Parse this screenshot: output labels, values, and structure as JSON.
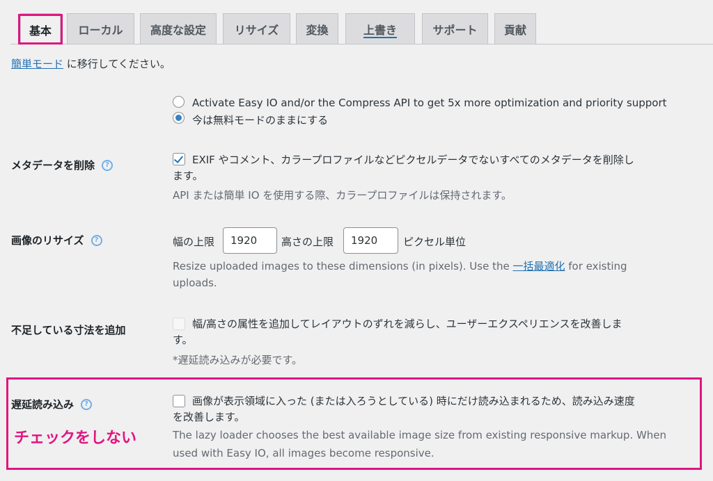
{
  "tabs": [
    {
      "label": "基本",
      "active": true
    },
    {
      "label": "ローカル"
    },
    {
      "label": "高度な設定"
    },
    {
      "label": "リサイズ"
    },
    {
      "label": "変換"
    },
    {
      "label": "上書き"
    },
    {
      "label": "サポート"
    },
    {
      "label": "貢献"
    }
  ],
  "easy_mode": {
    "link": "簡単モード",
    "text": " に移行してください。"
  },
  "mode_options": {
    "option1": "Activate Easy IO and/or the Compress API to get 5x more optimization and priority support",
    "option2": "今は無料モードのままにする",
    "selected": "option2"
  },
  "metadata": {
    "label": "メタデータを削除",
    "checked": true,
    "text_line1": "EXIF やコメント、カラープロファイルなどピクセルデータでないすべてのメタデータを削除し",
    "text_line2": "ます。",
    "desc": "API または簡単 IO を使用する際、カラープロファイルは保持されます。"
  },
  "resize": {
    "label": "画像のリサイズ",
    "width_label": "幅の上限",
    "width_value": "1920",
    "height_label": "高さの上限",
    "height_value": "1920",
    "unit": "ピクセル単位",
    "desc_line1_pre": "Resize uploaded images to these dimensions (in pixels). Use the ",
    "desc_link": "一括最適化",
    "desc_line1_post": " for existing",
    "desc_line2": "uploads."
  },
  "dimensions": {
    "label": "不足している寸法を追加",
    "text_line1": "幅/高さの属性を追加してレイアウトのずれを減らし、ユーザーエクスペリエンスを改善しま",
    "text_line2": "す。",
    "note": "*遅延読み込みが必要です。"
  },
  "lazy": {
    "label": "遅延読み込み",
    "checked": false,
    "text_line1": "画像が表示領域に入った (または入ろうとしている) 時にだけ読み込まれるため、読み込み速度",
    "text_line2": "を改善します。",
    "desc_line1": "The lazy loader chooses the best available image size from existing responsive markup. When",
    "desc_line2": "used with Easy IO, all images become responsive."
  },
  "annotation": "チェックをしない",
  "colors": {
    "highlight": "#e0157f",
    "link": "#2271b1",
    "background": "#f0f0f1"
  },
  "icons": {
    "help": "help-circle-icon",
    "check": "checkmark-icon"
  }
}
